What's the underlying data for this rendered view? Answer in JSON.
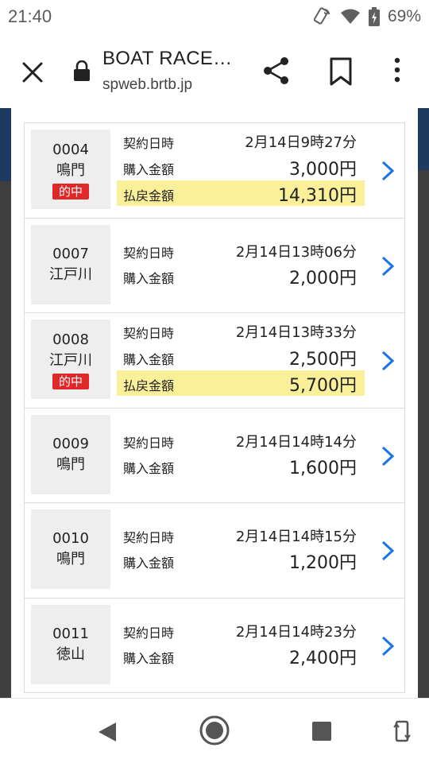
{
  "status_bar": {
    "time": "21:40",
    "battery": "69%",
    "icons": [
      "wifi-calling-icon",
      "wifi-icon",
      "battery-charging-icon"
    ]
  },
  "browser": {
    "title": "BOAT RACE…",
    "url": "spweb.brtb.jp",
    "icons": [
      "close-icon",
      "lock-icon",
      "share-icon",
      "bookmark-icon",
      "more-vert-icon"
    ]
  },
  "labels": {
    "contract": "契約日時",
    "purchase": "購入金額",
    "payout": "払戻金額",
    "hit": "的中"
  },
  "items": [
    {
      "no": "0004",
      "stadium": "鳴門",
      "hit": "的中",
      "datetime": "2月14日9時27分",
      "purchase": "3,000円",
      "payout": "14,310円"
    },
    {
      "no": "0007",
      "stadium": "江戸川",
      "datetime": "2月14日13時06分",
      "purchase": "2,000円"
    },
    {
      "no": "0008",
      "stadium": "江戸川",
      "hit": "的中",
      "datetime": "2月14日13時33分",
      "purchase": "2,500円",
      "payout": "5,700円"
    },
    {
      "no": "0009",
      "stadium": "鳴門",
      "datetime": "2月14日14時14分",
      "purchase": "1,600円"
    },
    {
      "no": "0010",
      "stadium": "鳴門",
      "datetime": "2月14日14時15分",
      "purchase": "1,200円"
    },
    {
      "no": "0011",
      "stadium": "徳山",
      "datetime": "2月14日14時23分",
      "purchase": "2,400円"
    }
  ],
  "colors": {
    "hit_badge": "#e02828",
    "payout_highlight": "#fbf09a",
    "chevron": "#1a73e8"
  }
}
